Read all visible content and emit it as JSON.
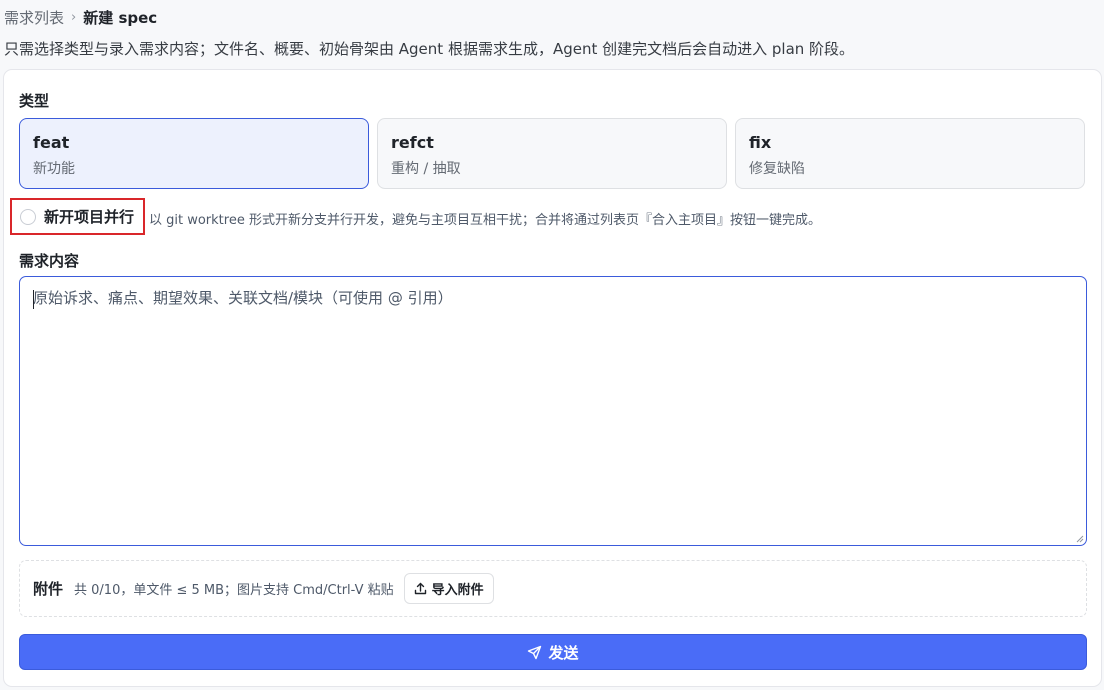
{
  "breadcrumb": {
    "parent": "需求列表",
    "separator": "›",
    "current": "新建 spec"
  },
  "description": "只需选择类型与录入需求内容；文件名、概要、初始骨架由 Agent 根据需求生成，Agent 创建完文档后会自动进入 plan 阶段。",
  "type_section": {
    "label": "类型",
    "options": [
      {
        "code": "feat",
        "desc": "新功能",
        "selected": true
      },
      {
        "code": "refct",
        "desc": "重构 / 抽取",
        "selected": false
      },
      {
        "code": "fix",
        "desc": "修复缺陷",
        "selected": false
      }
    ]
  },
  "parallel": {
    "label": "新开项目并行",
    "checked": false,
    "hint": "以 git worktree 形式开新分支并行开发，避免与主项目互相干扰；合并将通过列表页『合入主项目』按钮一键完成。"
  },
  "content_section": {
    "label": "需求内容",
    "value": "",
    "placeholder": "原始诉求、痛点、期望效果、关联文档/模块（可使用 @ 引用）"
  },
  "attachments": {
    "label": "附件",
    "info": "共 0/10，单文件 ≤ 5 MB；图片支持 Cmd/Ctrl-V 粘贴",
    "import_label": "导入附件"
  },
  "send_label": "发送",
  "colors": {
    "accent": "#4a6cf7",
    "accent_border": "#3b5bdb",
    "highlight": "#d9262a"
  }
}
